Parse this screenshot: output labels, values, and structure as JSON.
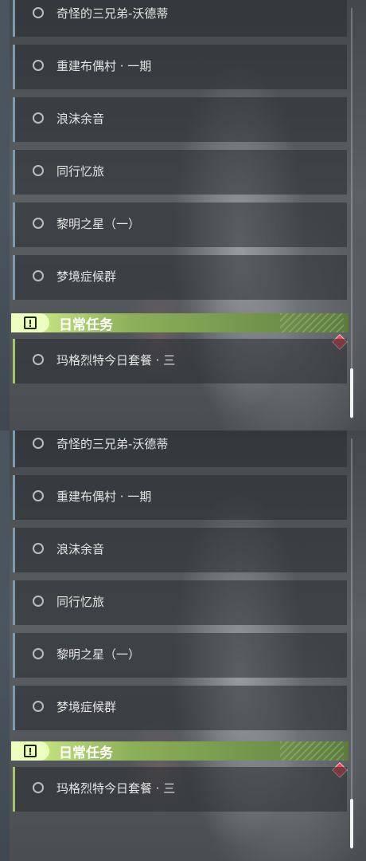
{
  "quest_list": {
    "items": [
      {
        "label": "奇怪的三兄弟-沃德蒂"
      },
      {
        "label": "重建布偶村 · 一期"
      },
      {
        "label": "浪沫余音"
      },
      {
        "label": "同行忆旅"
      },
      {
        "label": "黎明之星（一）"
      },
      {
        "label": "梦境症候群"
      }
    ],
    "daily_header": "日常任务",
    "daily_items": [
      {
        "label": "玛格烈特今日套餐 · 三"
      }
    ]
  },
  "colors": {
    "main_accent": "#7d9bb0",
    "daily_accent": "#a5c76c",
    "alert_marker": "#e04a55"
  },
  "icons": {
    "quest_status": "empty-circle-icon",
    "daily_header": "alert-box-icon",
    "new_marker": "red-diamond-icon"
  }
}
